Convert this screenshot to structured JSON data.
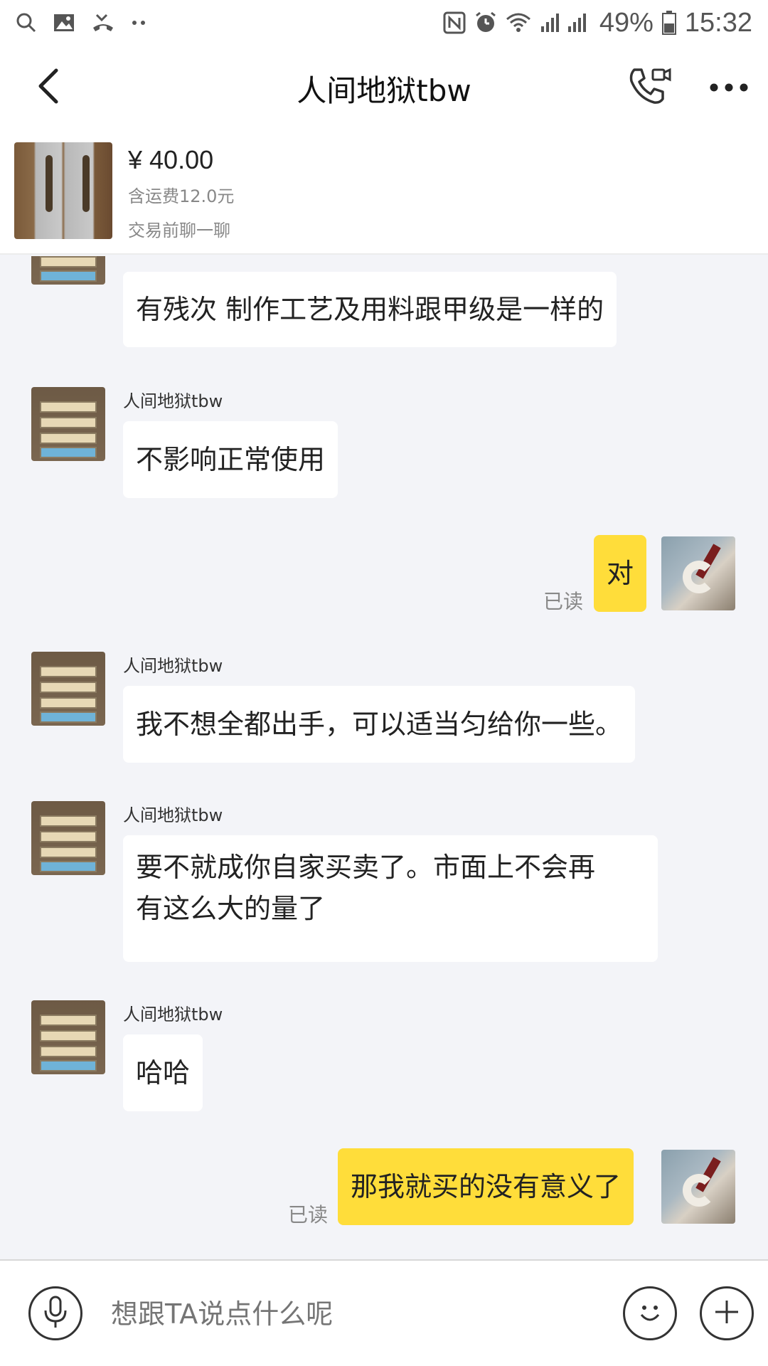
{
  "status_bar": {
    "battery": "49%",
    "time": "15:32",
    "icons": [
      "search-icon",
      "image-icon",
      "missed-call-icon",
      "more-dots-icon",
      "nfc-icon",
      "alarm-icon",
      "wifi-icon",
      "signal-icon",
      "battery-icon"
    ]
  },
  "header": {
    "title": "人间地狱tbw",
    "icons": [
      "back-arrow-icon",
      "phone-video-icon",
      "more-icon"
    ]
  },
  "product": {
    "price": "¥ 40.00",
    "shipping": "含运费12.0元",
    "hint": "交易前聊一聊"
  },
  "messages": [
    {
      "from": "other",
      "sender": "",
      "text": "有残次 制作工艺及用料跟甲级是一样的"
    },
    {
      "from": "other",
      "sender": "人间地狱tbw",
      "text": "不影响正常使用"
    },
    {
      "from": "me",
      "text": "对",
      "read": "已读"
    },
    {
      "from": "other",
      "sender": "人间地狱tbw",
      "text": "我不想全都出手，可以适当匀给你一些。"
    },
    {
      "from": "other",
      "sender": "人间地狱tbw",
      "text_line1": "要不就成你自家买卖了。市面上不会再",
      "text_line2": "有这么大的量了"
    },
    {
      "from": "other",
      "sender": "人间地狱tbw",
      "text": "哈哈"
    },
    {
      "from": "me",
      "text": "那我就买的没有意义了",
      "read": "已读"
    }
  ],
  "input": {
    "placeholder": "想跟TA说点什么呢",
    "icons": [
      "microphone-icon",
      "emoji-icon",
      "plus-icon"
    ]
  }
}
